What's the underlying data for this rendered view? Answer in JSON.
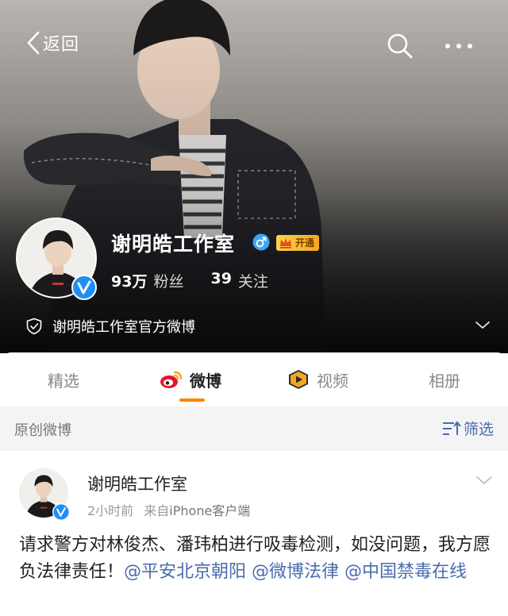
{
  "nav": {
    "back_label": "返回",
    "search_icon": "search-icon",
    "more_icon": "more-icon"
  },
  "profile": {
    "name": "谢明皓工作室",
    "gender_icon": "male-icon",
    "vip_label": "开通",
    "followers_count": "93万",
    "followers_label": "粉丝",
    "following_count": "39",
    "following_label": "关注",
    "official_label": "谢明皓工作室官方微博"
  },
  "tabs": [
    {
      "label": "精选",
      "icon": null,
      "active": false
    },
    {
      "label": "微博",
      "icon": "weibo-icon",
      "active": true
    },
    {
      "label": "视频",
      "icon": "video-icon",
      "active": false
    },
    {
      "label": "相册",
      "icon": null,
      "active": false
    }
  ],
  "filter": {
    "left_label": "原创微博",
    "filter_label": "筛选"
  },
  "post": {
    "author": "谢明皓工作室",
    "time": "2小时前",
    "source_prefix": "来自",
    "source": "iPhone客户端",
    "text_main": "请求警方对林俊杰、潘玮柏进行吸毒检测，如没问题，我方愿负法律责任！",
    "mentions": [
      "@平安北京朝阳",
      "@微博法律",
      "@中国禁毒在线"
    ]
  },
  "colors": {
    "accent_orange": "#ff8200",
    "link_blue": "#4a6cac",
    "verify_blue": "#1f8ff5",
    "gender_blue": "#3ea4f5",
    "vip_gold": "#fbd24a"
  }
}
